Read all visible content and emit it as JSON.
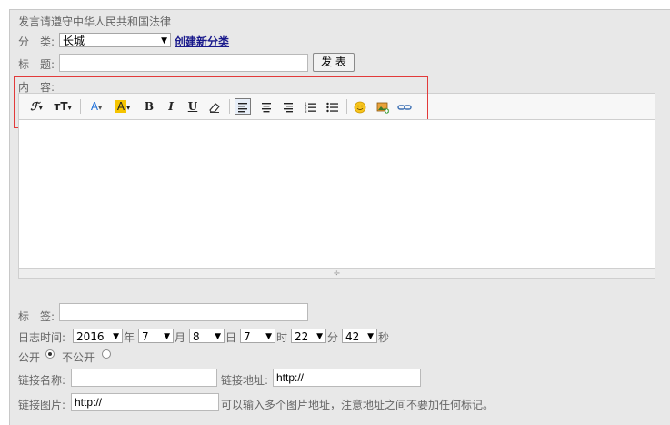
{
  "notice": "发言请遵守中华人民共和国法律",
  "category": {
    "label": "分　类:",
    "selected": "长城",
    "create_link": "创建新分类"
  },
  "title_row": {
    "label": "标　题:",
    "value": "",
    "submit": "发 表"
  },
  "content_label": "内　容:",
  "toolbar": {
    "font_family": "ℱ",
    "font_size": "тT",
    "font_color": "A",
    "highlight": "A",
    "bold": "B",
    "italic": "I",
    "underline": "U",
    "dropdown_arrow": "▾"
  },
  "editor": {
    "resize_glyph": "÷"
  },
  "tags": {
    "label": "标　签:",
    "value": ""
  },
  "log_time": {
    "label": "日志时间:",
    "year": "2016",
    "year_unit": "年",
    "month": "7",
    "month_unit": "月",
    "day": "8",
    "day_unit": "日",
    "hour": "7",
    "hour_unit": "时",
    "minute": "22",
    "minute_unit": "分",
    "second": "42",
    "second_unit": "秒"
  },
  "visibility": {
    "public": "公开",
    "private": "不公开",
    "selected": "public"
  },
  "link_name": {
    "label": "链接名称:",
    "value": ""
  },
  "link_url": {
    "label": "链接地址:",
    "value": "http://"
  },
  "link_image": {
    "label": "链接图片:",
    "value": "http://",
    "hint": "可以输入多个图片地址，注意地址之间不要加任何标记。"
  },
  "colors": {
    "panel_bg": "#e8e8e8",
    "highlight_box": "#e23a3a",
    "link": "#1a1a8c",
    "font_color_icon": "#1e6fd8",
    "highlight_icon": "#f5c400"
  }
}
